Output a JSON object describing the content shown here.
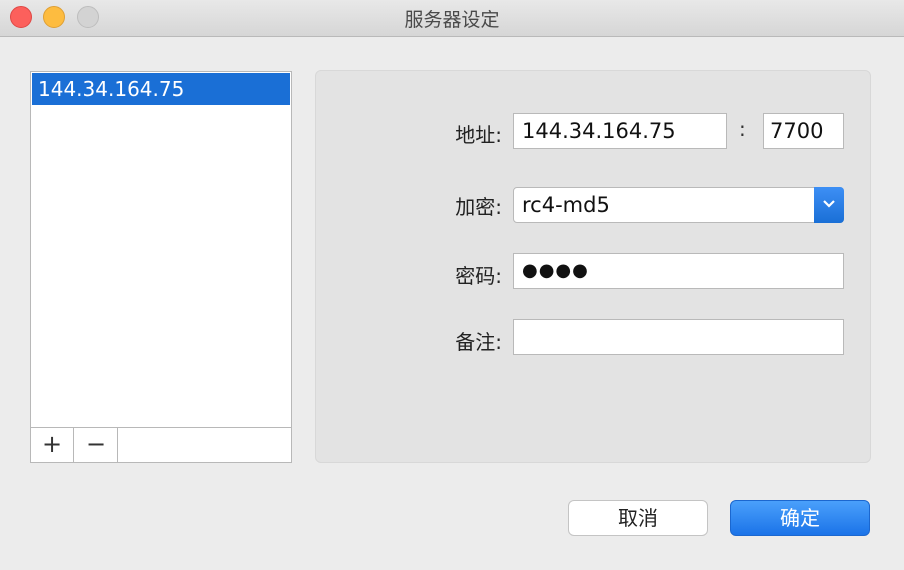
{
  "window": {
    "title": "服务器设定"
  },
  "server_list": {
    "items": [
      "144.34.164.75"
    ],
    "add_label": "+",
    "remove_label": "−"
  },
  "form": {
    "address_label": "地址:",
    "address_value": "144.34.164.75",
    "port_separator": ":",
    "port_value": "7700",
    "encryption_label": "加密:",
    "encryption_value": "rc4-md5",
    "password_label": "密码:",
    "password_value": "●●●●",
    "note_label": "备注:",
    "note_value": ""
  },
  "buttons": {
    "cancel": "取消",
    "ok": "确定"
  },
  "colors": {
    "accent": "#1a6fd6",
    "close": "#fc605c",
    "minimize": "#fdbc40",
    "zoom": "#d3d3d3"
  }
}
